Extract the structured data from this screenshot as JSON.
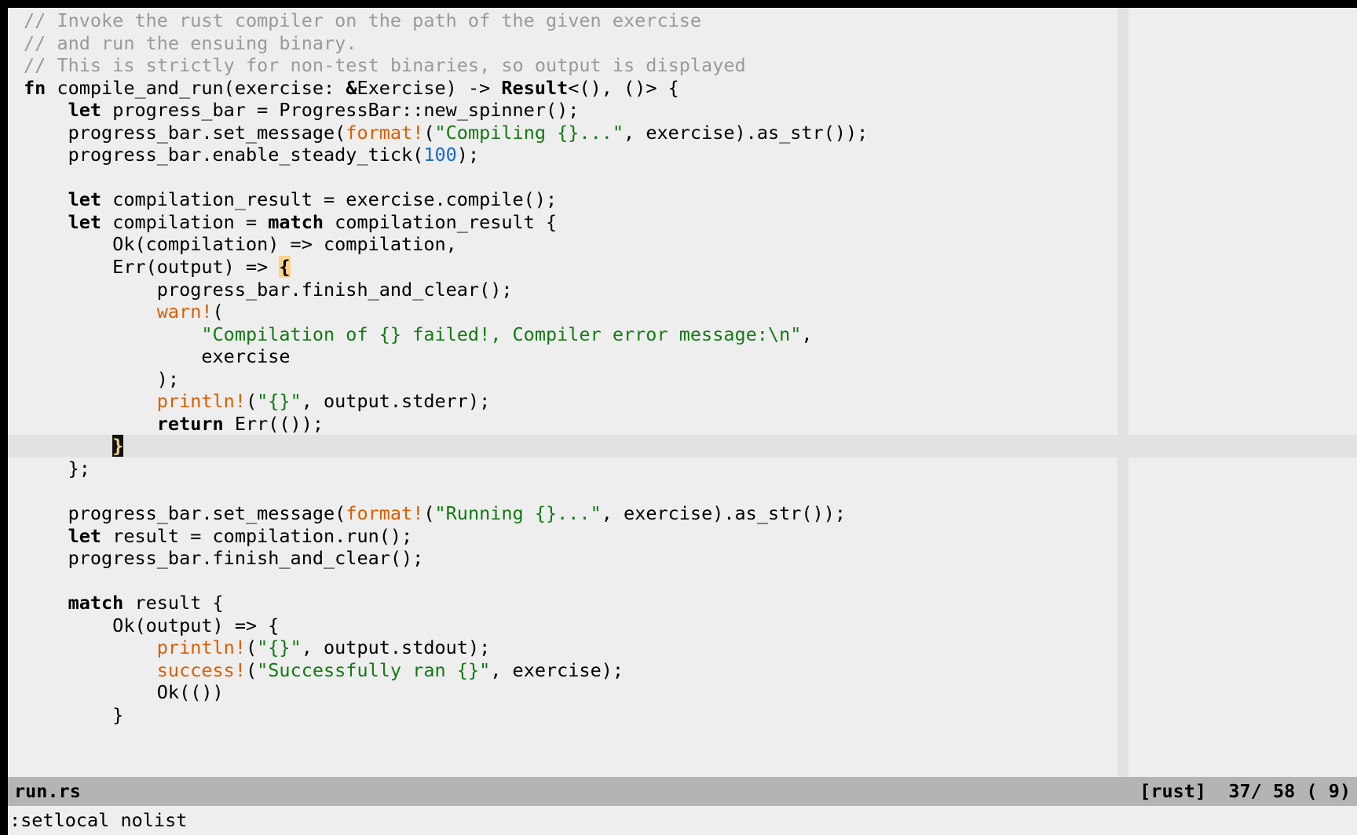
{
  "editor": {
    "name": "vim",
    "background_color": "#eeeeee",
    "foreground_color": "#000000",
    "cursorline_color": "#e2e2e2",
    "colorcolumn_color": "#e2e2e2",
    "statusline_color": "#b4b4b4",
    "comment_color": "#9a9a9a",
    "string_color": "#137a13",
    "macro_color": "#d95f02",
    "number_color": "#1569d6",
    "matchparen_color": "#fcd486",
    "cursor_bg_color": "#111111",
    "cursor_fg_color": "#f2cf8f"
  },
  "buffer": {
    "lines": [
      {
        "text": "// Invoke the rust compiler on the path of the given exercise",
        "tokens": [
          {
            "t": "// Invoke the rust compiler on the path of the given exercise",
            "c": "cmt"
          }
        ]
      },
      {
        "text": "// and run the ensuing binary.",
        "tokens": [
          {
            "t": "// and run the ensuing binary.",
            "c": "cmt"
          }
        ]
      },
      {
        "text": "// This is strictly for non-test binaries, so output is displayed",
        "tokens": [
          {
            "t": "// This is strictly for non-test binaries, so output is displayed",
            "c": "cmt"
          }
        ]
      },
      {
        "text": "fn compile_and_run(exercise: &Exercise) -> Result<(), ()> {",
        "tokens": [
          {
            "t": "fn",
            "c": "kw"
          },
          {
            "t": " compile_and_run(exercise: ",
            "c": "plain"
          },
          {
            "t": "&",
            "c": "kw"
          },
          {
            "t": "Exercise) -> ",
            "c": "plain"
          },
          {
            "t": "Result",
            "c": "typ"
          },
          {
            "t": "<(), ()> {",
            "c": "plain"
          }
        ]
      },
      {
        "text": "    let progress_bar = ProgressBar::new_spinner();",
        "tokens": [
          {
            "t": "    ",
            "c": "plain"
          },
          {
            "t": "let",
            "c": "kw"
          },
          {
            "t": " progress_bar = ProgressBar::new_spinner();",
            "c": "plain"
          }
        ]
      },
      {
        "text": "    progress_bar.set_message(format!(\"Compiling {}...\", exercise).as_str());",
        "tokens": [
          {
            "t": "    progress_bar.set_message(",
            "c": "plain"
          },
          {
            "t": "format!",
            "c": "macro"
          },
          {
            "t": "(",
            "c": "plain"
          },
          {
            "t": "\"Compiling {}...\"",
            "c": "str"
          },
          {
            "t": ", exercise).as_str());",
            "c": "plain"
          }
        ]
      },
      {
        "text": "    progress_bar.enable_steady_tick(100);",
        "tokens": [
          {
            "t": "    progress_bar.enable_steady_tick(",
            "c": "plain"
          },
          {
            "t": "100",
            "c": "num"
          },
          {
            "t": ");",
            "c": "plain"
          }
        ]
      },
      {
        "text": "",
        "tokens": []
      },
      {
        "text": "    let compilation_result = exercise.compile();",
        "tokens": [
          {
            "t": "    ",
            "c": "plain"
          },
          {
            "t": "let",
            "c": "kw"
          },
          {
            "t": " compilation_result = exercise.compile();",
            "c": "plain"
          }
        ]
      },
      {
        "text": "    let compilation = match compilation_result {",
        "tokens": [
          {
            "t": "    ",
            "c": "plain"
          },
          {
            "t": "let",
            "c": "kw"
          },
          {
            "t": " compilation = ",
            "c": "plain"
          },
          {
            "t": "match",
            "c": "kw"
          },
          {
            "t": " compilation_result {",
            "c": "plain"
          }
        ]
      },
      {
        "text": "        Ok(compilation) => compilation,",
        "tokens": [
          {
            "t": "        Ok(compilation) => compilation,",
            "c": "plain"
          }
        ]
      },
      {
        "text": "        Err(output) => {",
        "tokens": [
          {
            "t": "        Err(output) => ",
            "c": "plain"
          },
          {
            "t": "{",
            "c": "brcmatch"
          }
        ]
      },
      {
        "text": "            progress_bar.finish_and_clear();",
        "tokens": [
          {
            "t": "            progress_bar.finish_and_clear();",
            "c": "plain"
          }
        ]
      },
      {
        "text": "            warn!(",
        "tokens": [
          {
            "t": "            ",
            "c": "plain"
          },
          {
            "t": "warn!",
            "c": "macro"
          },
          {
            "t": "(",
            "c": "plain"
          }
        ]
      },
      {
        "text": "                \"Compilation of {} failed!, Compiler error message:\\n\",",
        "tokens": [
          {
            "t": "                ",
            "c": "plain"
          },
          {
            "t": "\"Compilation of {} failed!, Compiler error message:\\n\"",
            "c": "str"
          },
          {
            "t": ",",
            "c": "plain"
          }
        ]
      },
      {
        "text": "                exercise",
        "tokens": [
          {
            "t": "                exercise",
            "c": "plain"
          }
        ]
      },
      {
        "text": "            );",
        "tokens": [
          {
            "t": "            );",
            "c": "plain"
          }
        ]
      },
      {
        "text": "            println!(\"{}\", output.stderr);",
        "tokens": [
          {
            "t": "            ",
            "c": "plain"
          },
          {
            "t": "println!",
            "c": "macro"
          },
          {
            "t": "(",
            "c": "plain"
          },
          {
            "t": "\"{}\"",
            "c": "str"
          },
          {
            "t": ", output.stderr);",
            "c": "plain"
          }
        ]
      },
      {
        "text": "            return Err(());",
        "tokens": [
          {
            "t": "            ",
            "c": "plain"
          },
          {
            "t": "return",
            "c": "kw"
          },
          {
            "t": " Err(());",
            "c": "plain"
          }
        ]
      },
      {
        "text": "        }",
        "cursorline": true,
        "tokens": [
          {
            "t": "        ",
            "c": "plain"
          },
          {
            "t": "}",
            "c": "cursor"
          }
        ]
      },
      {
        "text": "    };",
        "tokens": [
          {
            "t": "    };",
            "c": "plain"
          }
        ]
      },
      {
        "text": "",
        "tokens": []
      },
      {
        "text": "    progress_bar.set_message(format!(\"Running {}...\", exercise).as_str());",
        "tokens": [
          {
            "t": "    progress_bar.set_message(",
            "c": "plain"
          },
          {
            "t": "format!",
            "c": "macro"
          },
          {
            "t": "(",
            "c": "plain"
          },
          {
            "t": "\"Running {}...\"",
            "c": "str"
          },
          {
            "t": ", exercise).as_str());",
            "c": "plain"
          }
        ]
      },
      {
        "text": "    let result = compilation.run();",
        "tokens": [
          {
            "t": "    ",
            "c": "plain"
          },
          {
            "t": "let",
            "c": "kw"
          },
          {
            "t": " result = compilation.run();",
            "c": "plain"
          }
        ]
      },
      {
        "text": "    progress_bar.finish_and_clear();",
        "tokens": [
          {
            "t": "    progress_bar.finish_and_clear();",
            "c": "plain"
          }
        ]
      },
      {
        "text": "",
        "tokens": []
      },
      {
        "text": "    match result {",
        "tokens": [
          {
            "t": "    ",
            "c": "plain"
          },
          {
            "t": "match",
            "c": "kw"
          },
          {
            "t": " result {",
            "c": "plain"
          }
        ]
      },
      {
        "text": "        Ok(output) => {",
        "tokens": [
          {
            "t": "        Ok(output) => {",
            "c": "plain"
          }
        ]
      },
      {
        "text": "            println!(\"{}\", output.stdout);",
        "tokens": [
          {
            "t": "            ",
            "c": "plain"
          },
          {
            "t": "println!",
            "c": "macro"
          },
          {
            "t": "(",
            "c": "plain"
          },
          {
            "t": "\"{}\"",
            "c": "str"
          },
          {
            "t": ", output.stdout);",
            "c": "plain"
          }
        ]
      },
      {
        "text": "            success!(\"Successfully ran {}\", exercise);",
        "tokens": [
          {
            "t": "            ",
            "c": "plain"
          },
          {
            "t": "success!",
            "c": "macro"
          },
          {
            "t": "(",
            "c": "plain"
          },
          {
            "t": "\"Successfully ran {}\"",
            "c": "str"
          },
          {
            "t": ", exercise);",
            "c": "plain"
          }
        ]
      },
      {
        "text": "            Ok(())",
        "tokens": [
          {
            "t": "            Ok(())",
            "c": "plain"
          }
        ]
      },
      {
        "text": "        }",
        "tokens": [
          {
            "t": "        }",
            "c": "plain"
          }
        ]
      }
    ]
  },
  "statusline": {
    "filename": "run.rs",
    "filetype": "[rust]",
    "position": "37/ 58 ( 9)",
    "right": "[rust]  37/ 58 ( 9)"
  },
  "cmdline": {
    "text": ":setlocal nolist"
  }
}
